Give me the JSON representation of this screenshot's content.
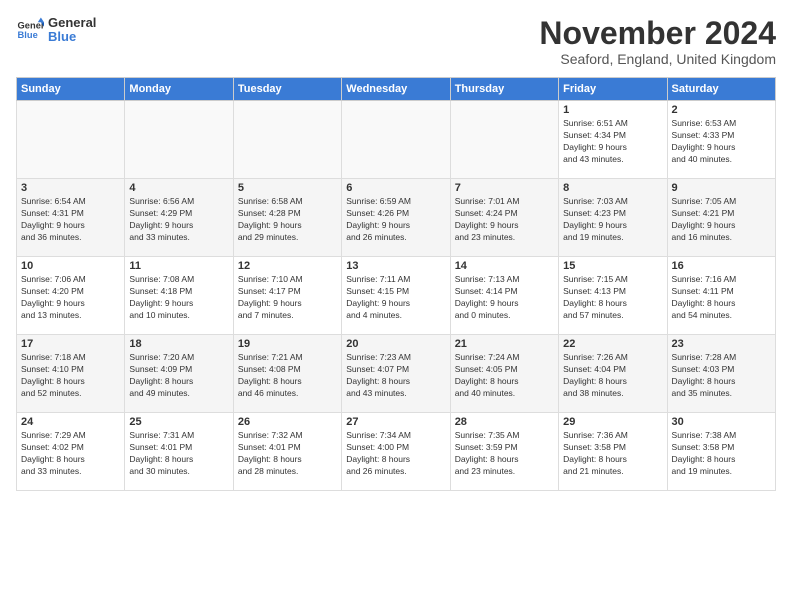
{
  "logo": {
    "line1": "General",
    "line2": "Blue"
  },
  "title": "November 2024",
  "location": "Seaford, England, United Kingdom",
  "headers": [
    "Sunday",
    "Monday",
    "Tuesday",
    "Wednesday",
    "Thursday",
    "Friday",
    "Saturday"
  ],
  "weeks": [
    [
      {
        "day": "",
        "info": ""
      },
      {
        "day": "",
        "info": ""
      },
      {
        "day": "",
        "info": ""
      },
      {
        "day": "",
        "info": ""
      },
      {
        "day": "",
        "info": ""
      },
      {
        "day": "1",
        "info": "Sunrise: 6:51 AM\nSunset: 4:34 PM\nDaylight: 9 hours\nand 43 minutes."
      },
      {
        "day": "2",
        "info": "Sunrise: 6:53 AM\nSunset: 4:33 PM\nDaylight: 9 hours\nand 40 minutes."
      }
    ],
    [
      {
        "day": "3",
        "info": "Sunrise: 6:54 AM\nSunset: 4:31 PM\nDaylight: 9 hours\nand 36 minutes."
      },
      {
        "day": "4",
        "info": "Sunrise: 6:56 AM\nSunset: 4:29 PM\nDaylight: 9 hours\nand 33 minutes."
      },
      {
        "day": "5",
        "info": "Sunrise: 6:58 AM\nSunset: 4:28 PM\nDaylight: 9 hours\nand 29 minutes."
      },
      {
        "day": "6",
        "info": "Sunrise: 6:59 AM\nSunset: 4:26 PM\nDaylight: 9 hours\nand 26 minutes."
      },
      {
        "day": "7",
        "info": "Sunrise: 7:01 AM\nSunset: 4:24 PM\nDaylight: 9 hours\nand 23 minutes."
      },
      {
        "day": "8",
        "info": "Sunrise: 7:03 AM\nSunset: 4:23 PM\nDaylight: 9 hours\nand 19 minutes."
      },
      {
        "day": "9",
        "info": "Sunrise: 7:05 AM\nSunset: 4:21 PM\nDaylight: 9 hours\nand 16 minutes."
      }
    ],
    [
      {
        "day": "10",
        "info": "Sunrise: 7:06 AM\nSunset: 4:20 PM\nDaylight: 9 hours\nand 13 minutes."
      },
      {
        "day": "11",
        "info": "Sunrise: 7:08 AM\nSunset: 4:18 PM\nDaylight: 9 hours\nand 10 minutes."
      },
      {
        "day": "12",
        "info": "Sunrise: 7:10 AM\nSunset: 4:17 PM\nDaylight: 9 hours\nand 7 minutes."
      },
      {
        "day": "13",
        "info": "Sunrise: 7:11 AM\nSunset: 4:15 PM\nDaylight: 9 hours\nand 4 minutes."
      },
      {
        "day": "14",
        "info": "Sunrise: 7:13 AM\nSunset: 4:14 PM\nDaylight: 9 hours\nand 0 minutes."
      },
      {
        "day": "15",
        "info": "Sunrise: 7:15 AM\nSunset: 4:13 PM\nDaylight: 8 hours\nand 57 minutes."
      },
      {
        "day": "16",
        "info": "Sunrise: 7:16 AM\nSunset: 4:11 PM\nDaylight: 8 hours\nand 54 minutes."
      }
    ],
    [
      {
        "day": "17",
        "info": "Sunrise: 7:18 AM\nSunset: 4:10 PM\nDaylight: 8 hours\nand 52 minutes."
      },
      {
        "day": "18",
        "info": "Sunrise: 7:20 AM\nSunset: 4:09 PM\nDaylight: 8 hours\nand 49 minutes."
      },
      {
        "day": "19",
        "info": "Sunrise: 7:21 AM\nSunset: 4:08 PM\nDaylight: 8 hours\nand 46 minutes."
      },
      {
        "day": "20",
        "info": "Sunrise: 7:23 AM\nSunset: 4:07 PM\nDaylight: 8 hours\nand 43 minutes."
      },
      {
        "day": "21",
        "info": "Sunrise: 7:24 AM\nSunset: 4:05 PM\nDaylight: 8 hours\nand 40 minutes."
      },
      {
        "day": "22",
        "info": "Sunrise: 7:26 AM\nSunset: 4:04 PM\nDaylight: 8 hours\nand 38 minutes."
      },
      {
        "day": "23",
        "info": "Sunrise: 7:28 AM\nSunset: 4:03 PM\nDaylight: 8 hours\nand 35 minutes."
      }
    ],
    [
      {
        "day": "24",
        "info": "Sunrise: 7:29 AM\nSunset: 4:02 PM\nDaylight: 8 hours\nand 33 minutes."
      },
      {
        "day": "25",
        "info": "Sunrise: 7:31 AM\nSunset: 4:01 PM\nDaylight: 8 hours\nand 30 minutes."
      },
      {
        "day": "26",
        "info": "Sunrise: 7:32 AM\nSunset: 4:01 PM\nDaylight: 8 hours\nand 28 minutes."
      },
      {
        "day": "27",
        "info": "Sunrise: 7:34 AM\nSunset: 4:00 PM\nDaylight: 8 hours\nand 26 minutes."
      },
      {
        "day": "28",
        "info": "Sunrise: 7:35 AM\nSunset: 3:59 PM\nDaylight: 8 hours\nand 23 minutes."
      },
      {
        "day": "29",
        "info": "Sunrise: 7:36 AM\nSunset: 3:58 PM\nDaylight: 8 hours\nand 21 minutes."
      },
      {
        "day": "30",
        "info": "Sunrise: 7:38 AM\nSunset: 3:58 PM\nDaylight: 8 hours\nand 19 minutes."
      }
    ]
  ]
}
